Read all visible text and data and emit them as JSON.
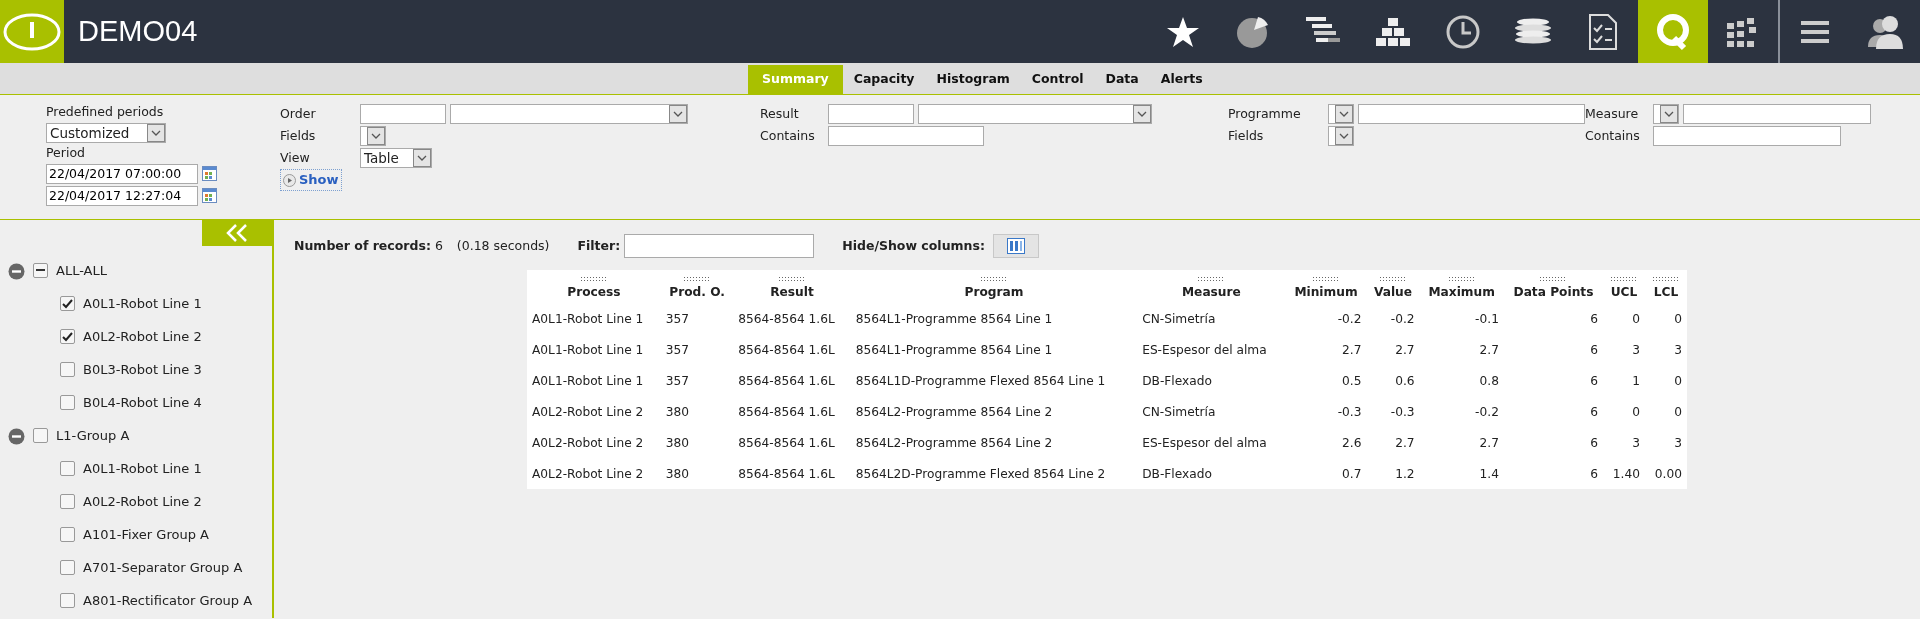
{
  "header": {
    "title": "DEMO04",
    "toolbar": [
      {
        "kind": "star",
        "selected": false
      },
      {
        "kind": "pie",
        "selected": false
      },
      {
        "kind": "gantt",
        "selected": false
      },
      {
        "kind": "blocks",
        "selected": false
      },
      {
        "kind": "clock",
        "selected": false
      },
      {
        "kind": "coins",
        "selected": false
      },
      {
        "kind": "checklist",
        "selected": false
      },
      {
        "kind": "q",
        "selected": true
      },
      {
        "kind": "grid",
        "selected": false
      },
      {
        "kind": "menu",
        "selected": false
      },
      {
        "kind": "user",
        "selected": false
      }
    ]
  },
  "tabs": [
    {
      "label": "Summary",
      "selected": true
    },
    {
      "label": "Capacity",
      "selected": false
    },
    {
      "label": "Histogram",
      "selected": false
    },
    {
      "label": "Control",
      "selected": false
    },
    {
      "label": "Data",
      "selected": false
    },
    {
      "label": "Alerts",
      "selected": false
    }
  ],
  "filters": {
    "predefined_periods_label": "Predefined periods",
    "predefined_periods_value": "Customized",
    "period_label": "Period",
    "period_from": "22/04/2017 07:00:00",
    "period_to": "22/04/2017 12:27:04",
    "order_label": "Order",
    "fields_label": "Fields",
    "view_label": "View",
    "view_value": "Table",
    "show_button": "Show",
    "result_label": "Result",
    "result_contains_label": "Contains",
    "programme_label": "Programme",
    "programme_fields_label": "Fields",
    "measure_label": "Measure",
    "measure_contains_label": "Contains"
  },
  "tree": [
    {
      "label": "ALL-ALL",
      "expanded": true,
      "partial": true,
      "children": [
        {
          "label": "A0L1-Robot Line 1",
          "checked": true
        },
        {
          "label": "A0L2-Robot Line 2",
          "checked": true
        },
        {
          "label": "B0L3-Robot Line 3",
          "checked": false
        },
        {
          "label": "B0L4-Robot Line 4",
          "checked": false
        }
      ]
    },
    {
      "label": "L1-Group A",
      "expanded": true,
      "partial": false,
      "children": [
        {
          "label": "A0L1-Robot Line 1",
          "checked": false
        },
        {
          "label": "A0L2-Robot Line 2",
          "checked": false
        },
        {
          "label": "A101-Fixer Group A",
          "checked": false
        },
        {
          "label": "A701-Separator Group A",
          "checked": false
        },
        {
          "label": "A801-Rectificator Group A",
          "checked": false
        }
      ]
    }
  ],
  "records": {
    "count_text": "**Number of records:** 6",
    "time": "(0.18 seconds)",
    "filter_label": "Filter:",
    "columns_label": "Hide/Show columns:"
  },
  "table": {
    "columns": [
      {
        "label": "Process",
        "kind": "text"
      },
      {
        "label": "Prod. O.",
        "kind": "text"
      },
      {
        "label": "Result",
        "kind": "text"
      },
      {
        "label": "Program",
        "kind": "text"
      },
      {
        "label": "Measure",
        "kind": "text"
      },
      {
        "label": "Minimum",
        "kind": "number"
      },
      {
        "label": "Value",
        "kind": "number"
      },
      {
        "label": "Maximum",
        "kind": "number"
      },
      {
        "label": "Data Points",
        "kind": "number"
      },
      {
        "label": "UCL",
        "kind": "number"
      },
      {
        "label": "LCL",
        "kind": "number"
      }
    ],
    "rows": [
      [
        "A0L1-Robot Line 1",
        "357",
        "8564-8564 1.6L",
        "8564L1-Programme 8564 Line 1",
        "CN-Simetría",
        "-0.2",
        "-0.2",
        "-0.1",
        "6",
        "0",
        "0"
      ],
      [
        "A0L1-Robot Line 1",
        "357",
        "8564-8564 1.6L",
        "8564L1-Programme 8564 Line 1",
        "ES-Espesor del alma",
        "2.7",
        "2.7",
        "2.7",
        "6",
        "3",
        "3"
      ],
      [
        "A0L1-Robot Line 1",
        "357",
        "8564-8564 1.6L",
        "8564L1D-Programme Flexed 8564 Line 1",
        "DB-Flexado",
        "0.5",
        "0.6",
        "0.8",
        "6",
        "1",
        "0"
      ],
      [
        "A0L2-Robot Line 2",
        "380",
        "8564-8564 1.6L",
        "8564L2-Programme 8564 Line 2",
        "CN-Simetría",
        "-0.3",
        "-0.3",
        "-0.2",
        "6",
        "0",
        "0"
      ],
      [
        "A0L2-Robot Line 2",
        "380",
        "8564-8564 1.6L",
        "8564L2-Programme 8564 Line 2",
        "ES-Espesor del alma",
        "2.6",
        "2.7",
        "2.7",
        "6",
        "3",
        "3"
      ],
      [
        "A0L2-Robot Line 2",
        "380",
        "8564-8564 1.6L",
        "8564L2D-Programme Flexed 8564 Line 2",
        "DB-Flexado",
        "0.7",
        "1.2",
        "1.4",
        "6",
        "1.40",
        "0.00"
      ]
    ]
  }
}
